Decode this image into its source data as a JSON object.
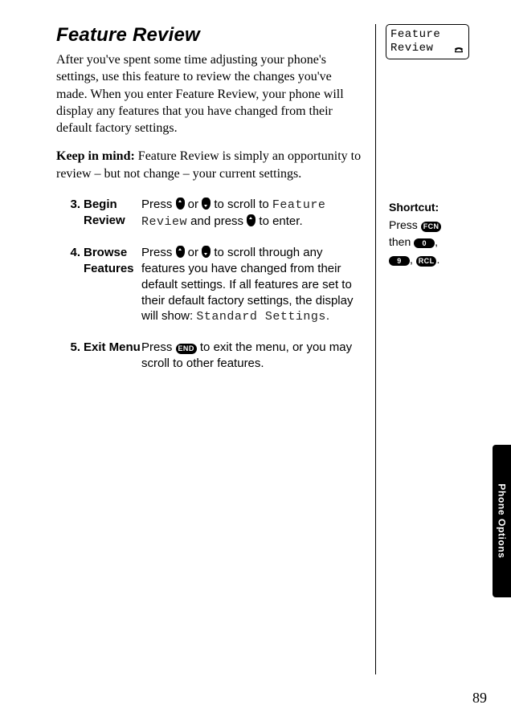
{
  "title": "Feature Review",
  "intro": "After you've spent some time adjusting your phone's settings, use this feature to review the changes you've made. When you enter Feature Review, your phone will display any features that you have changed from their default factory settings.",
  "keep_lead": "Keep in mind:",
  "keep_rest": " Feature Review is simply an opportunity to review – but not change – your current settings.",
  "steps": [
    {
      "num": "3.",
      "label": "Begin Review",
      "pre1": "Press ",
      "mid1": " or ",
      "post1": " to scroll to ",
      "lcd1": "Feature Review",
      "post2": " and press ",
      "post3": " to enter."
    },
    {
      "num": "4.",
      "label": "Browse Features",
      "pre1": "Press ",
      "mid1": " or ",
      "post1": " to scroll through any features you have changed from their default set­tings. If all features are set to their default factory settings, the display will show: ",
      "lcd1": "Standard Settings",
      "post2": "."
    },
    {
      "num": "5.",
      "label": "Exit Menu",
      "pre1": "Press ",
      "post1": " to exit the menu, or you may scroll to other features."
    }
  ],
  "keys": {
    "end": "END",
    "fcn": "FCN",
    "zero": "0",
    "nine": "9",
    "rcl": "RCL"
  },
  "display": {
    "line1": "Feature",
    "line2": "Review"
  },
  "shortcut": {
    "title": "Shortcut:",
    "press": "Press ",
    "then": "then ",
    "comma1": ",",
    "comma2": ", ",
    "period": "."
  },
  "side_tab": "Phone Options",
  "page_number": "89"
}
